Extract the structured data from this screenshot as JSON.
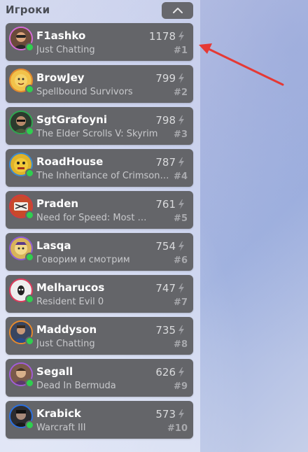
{
  "header": {
    "title": "Игроки",
    "collapse_icon": "chevron-up-icon"
  },
  "colors": {
    "card": "#646569",
    "online": "#2fcf4f",
    "arrow": "#e53935"
  },
  "players": [
    {
      "name": "F1ashko",
      "game": "Just Chatting",
      "viewers": "1178",
      "rank": "#1",
      "ring": "#d66bd9",
      "avatar_bg": "#6a4a3a"
    },
    {
      "name": "BrowJey",
      "game": "Spellbound Survivors",
      "viewers": "799",
      "rank": "#2",
      "ring": "#e88a2b",
      "avatar_bg": "#f2c24a"
    },
    {
      "name": "SgtGrafoyni",
      "game": "The Elder Scrolls V: Skyrim",
      "viewers": "798",
      "rank": "#3",
      "ring": "#2ea84f",
      "avatar_bg": "#2b3a2d"
    },
    {
      "name": "RoadHouse",
      "game": "The Inheritance of Crimson…",
      "viewers": "787",
      "rank": "#4",
      "ring": "#3b8bd1",
      "avatar_bg": "#e0b42a"
    },
    {
      "name": "Praden",
      "game": "Need for Speed: Most …",
      "viewers": "761",
      "rank": "#5",
      "ring": "#d83a3a",
      "avatar_bg": "#c84a2a"
    },
    {
      "name": "Lasqa",
      "game": "Говорим и смотрим",
      "viewers": "754",
      "rank": "#6",
      "ring": "#8f5bd6",
      "avatar_bg": "#d8b35a"
    },
    {
      "name": "Melharucos",
      "game": "Resident Evil 0",
      "viewers": "747",
      "rank": "#7",
      "ring": "#e23a5c",
      "avatar_bg": "#eeeeee"
    },
    {
      "name": "Maddyson",
      "game": "Just Chatting",
      "viewers": "735",
      "rank": "#8",
      "ring": "#e88a2b",
      "avatar_bg": "#3a4660"
    },
    {
      "name": "Segall",
      "game": "Dead In Bermuda",
      "viewers": "626",
      "rank": "#9",
      "ring": "#a25cd8",
      "avatar_bg": "#7a5a4a"
    },
    {
      "name": "Krabick",
      "game": "Warcraft III",
      "viewers": "573",
      "rank": "#10",
      "ring": "#2a6fe0",
      "avatar_bg": "#2c2c30"
    }
  ]
}
